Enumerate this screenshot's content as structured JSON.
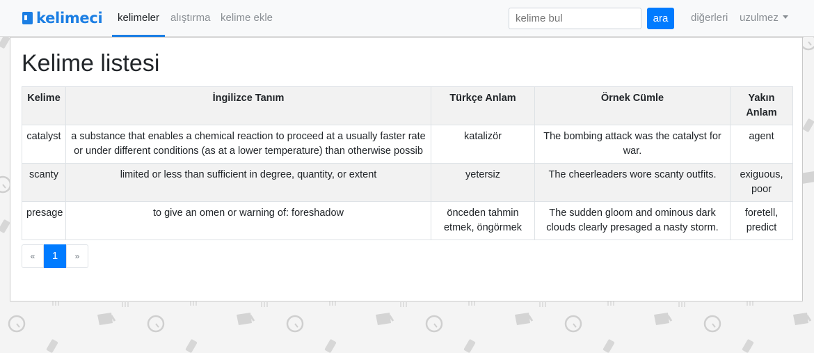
{
  "navbar": {
    "brand": "kelimeci",
    "links": [
      {
        "label": "kelimeler",
        "active": true
      },
      {
        "label": "alıştırma",
        "active": false
      },
      {
        "label": "kelime ekle",
        "active": false
      }
    ],
    "search": {
      "placeholder": "kelime bul",
      "button_label": "ara"
    },
    "others_label": "diğerleri",
    "user_label": "uzulmez"
  },
  "main": {
    "title": "Kelime listesi",
    "table": {
      "headers": [
        "Kelime",
        "İngilizce Tanım",
        "Türkçe Anlam",
        "Örnek Cümle",
        "Yakın Anlam"
      ],
      "rows": [
        [
          "catalyst",
          "a substance that enables a chemical reaction to proceed at a usually faster rate or under different conditions (as at a lower temperature) than otherwise possib",
          "katalizör",
          "The bombing attack was the catalyst for war.",
          "agent"
        ],
        [
          "scanty",
          "limited or less than sufficient in degree, quantity, or extent",
          "yetersiz",
          "The cheerleaders wore scanty outfits.",
          "exiguous, poor"
        ],
        [
          "presage",
          "to give an omen or warning of: foreshadow",
          "önceden tahmin etmek, öngörmek",
          "The sudden gloom and ominous dark clouds clearly presaged a nasty storm.",
          "foretell, predict"
        ]
      ]
    },
    "pagination": {
      "prev": "«",
      "current": "1",
      "next": "»"
    }
  },
  "colors": {
    "brand": "#1b7ee3",
    "primary": "#007bff",
    "stripe": "#f2f2f2"
  },
  "icons": [
    "brand-bookmark-icon",
    "dropdown-caret-icon",
    "background-pattern-icons"
  ]
}
